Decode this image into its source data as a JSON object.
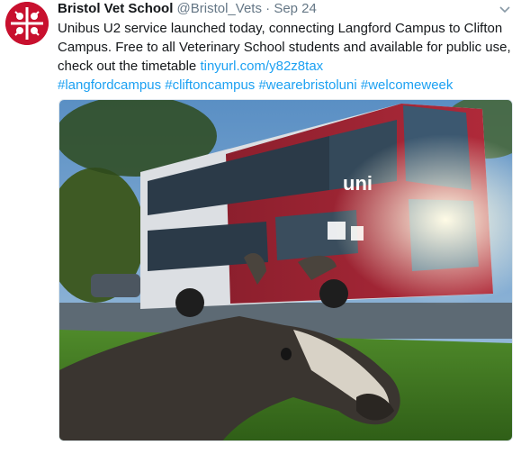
{
  "tweet": {
    "display_name": "Bristol Vet School",
    "handle": "@Bristol_Vets",
    "separator": "·",
    "date": "Sep 24",
    "text_line1": "Unibus U2 service launched today, connecting Langford Campus to Clifton",
    "text_line2": "Campus.  Free to all Veterinary School students and available for public use,",
    "text_line3_prefix": "check out the timetable ",
    "link": "tinyurl.com/y82z8tax",
    "hashtags": "#langfordcampus #cliftoncampus #wearebristoluni #welcomeweek"
  },
  "photo": {
    "bus_brand": "uni"
  },
  "icons": {
    "avatar": "bristol-vet-school-logo",
    "menu": "chevron-down-icon"
  },
  "colors": {
    "link": "#1da1f2",
    "secondary_text": "#657786",
    "avatar_red": "#c8102e"
  }
}
